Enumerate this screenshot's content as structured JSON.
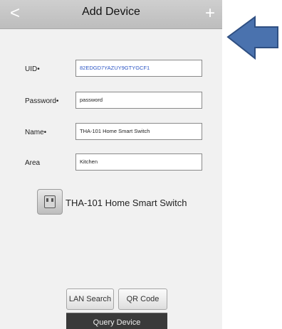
{
  "header": {
    "title": "Add Device",
    "back_icon": "chevron-left-icon",
    "add_icon": "plus-icon"
  },
  "form": {
    "uid": {
      "label": "UID•",
      "value": "82EDGD7YAZUY9GTYGCF1"
    },
    "password": {
      "label": "Password•",
      "value": "password"
    },
    "name": {
      "label": "Name•",
      "value": "THA-101 Home Smart Switch"
    },
    "area": {
      "label": "Area",
      "value": "Kitchen"
    }
  },
  "device": {
    "icon": "switch-icon",
    "name": "THA-101 Home Smart Switch"
  },
  "buttons": {
    "lan_search": "LAN Search",
    "qr_code": "QR Code",
    "query_device": "Query Device"
  },
  "annotation": {
    "icon": "arrow-left-icon",
    "color": "#4a72ae"
  }
}
